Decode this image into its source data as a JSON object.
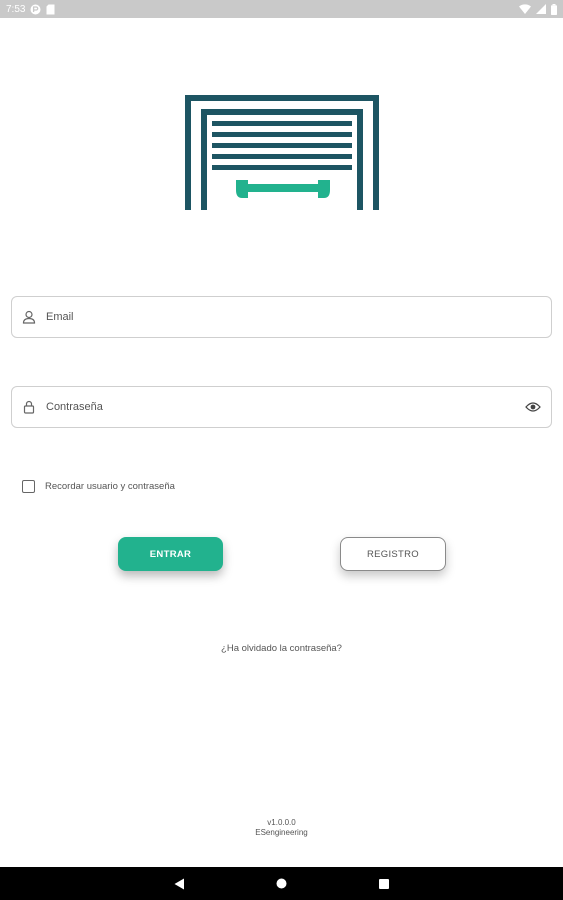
{
  "status_bar": {
    "time": "7:53",
    "left_icons": [
      "app-notification-icon",
      "sd-card-icon"
    ],
    "right_icons": [
      "wifi-icon",
      "signal-icon",
      "battery-icon"
    ]
  },
  "logo": {
    "name": "garage-door-logo",
    "colors": {
      "frame": "#1d5563",
      "accent": "#22b28e"
    }
  },
  "form": {
    "email": {
      "placeholder": "Email",
      "value": "",
      "icon": "person-icon"
    },
    "password": {
      "placeholder": "Contraseña",
      "value": "",
      "icon": "lock-icon",
      "toggle_icon": "eye-icon"
    },
    "remember_label": "Recordar usuario y contraseña",
    "remember_checked": false
  },
  "buttons": {
    "enter_label": "ENTRAR",
    "register_label": "REGISTRO"
  },
  "forgot_link": "¿Ha olvidado la contraseña?",
  "footer": {
    "version": "v1.0.0.0",
    "company": "ESengineering"
  },
  "nav_bar": {
    "icons": [
      "back-icon",
      "home-icon",
      "recents-icon"
    ]
  },
  "colors": {
    "primary": "#22b28e",
    "dark": "#1d5563",
    "text": "#555555",
    "border": "#cfcfcf"
  }
}
